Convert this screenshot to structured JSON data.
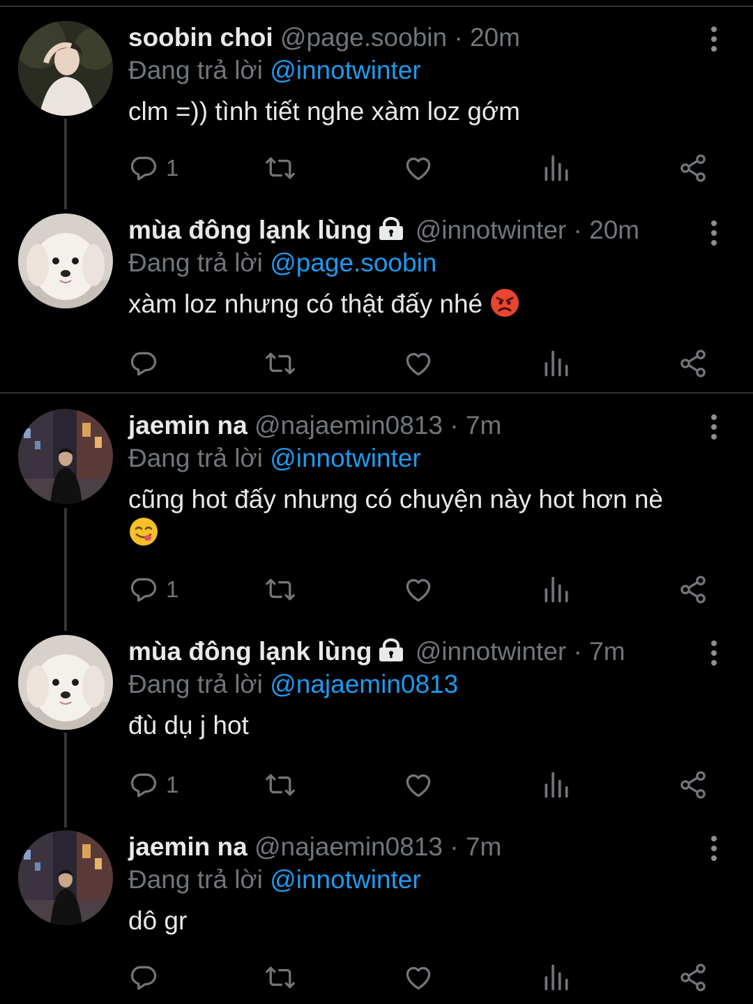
{
  "tweets": [
    {
      "name": "soobin choi",
      "handle": "@page.soobin",
      "dot": "·",
      "time": "20m",
      "reply_prefix": "Đang trả lời",
      "reply_to": "@innotwinter",
      "text": "clm =)) tình tiết nghe xàm loz gớm",
      "reply_count": "1",
      "locked": false,
      "emoji": null
    },
    {
      "name": "mùa đông lạnk lùng",
      "handle": "@innotwinter",
      "dot": "·",
      "time": "20m",
      "reply_prefix": "Đang trả lời",
      "reply_to": "@page.soobin",
      "text": "xàm loz nhưng có thật đấy nhé",
      "reply_count": "",
      "locked": true,
      "emoji": "angry-face-emoji"
    },
    {
      "name": "jaemin na",
      "handle": "@najaemin0813",
      "dot": "·",
      "time": "7m",
      "reply_prefix": "Đang trả lời",
      "reply_to": "@innotwinter",
      "text": "cũng hot đấy nhưng có chuyện này hot hơn nè",
      "reply_count": "1",
      "locked": false,
      "emoji": "yummy-face-emoji"
    },
    {
      "name": "mùa đông lạnk lùng",
      "handle": "@innotwinter",
      "dot": "·",
      "time": "7m",
      "reply_prefix": "Đang trả lời",
      "reply_to": "@najaemin0813",
      "text": "đù dụ j hot",
      "reply_count": "1",
      "locked": true,
      "emoji": null
    },
    {
      "name": "jaemin na",
      "handle": "@najaemin0813",
      "dot": "·",
      "time": "7m",
      "reply_prefix": "Đang trả lời",
      "reply_to": "@innotwinter",
      "text": "dô gr",
      "reply_count": "",
      "locked": false,
      "emoji": null
    }
  ],
  "icons": {
    "reply": "reply-icon",
    "retweet": "retweet-icon",
    "like": "heart-icon",
    "views": "views-icon",
    "share": "share-icon",
    "more": "more-vertical-icon",
    "lock": "lock-icon"
  },
  "colors": {
    "background": "#000000",
    "text": "#e7e9ea",
    "muted": "#71767b",
    "mention": "#1d9bf0",
    "divider": "#2f3336"
  }
}
